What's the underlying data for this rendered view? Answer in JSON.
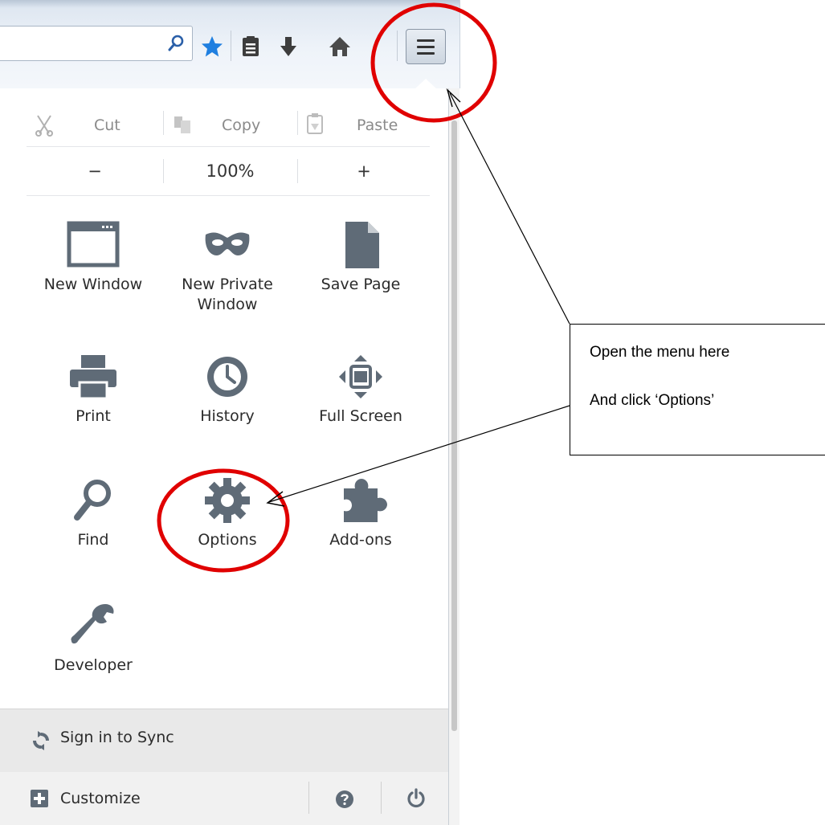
{
  "edit": {
    "cut": "Cut",
    "copy": "Copy",
    "paste": "Paste"
  },
  "zoom": {
    "minus": "−",
    "level": "100%",
    "plus": "+"
  },
  "grid": {
    "new_window": "New Window",
    "new_private_line1": "New Private",
    "new_private_line2": "Window",
    "save_page": "Save Page",
    "print": "Print",
    "history": "History",
    "full_screen": "Full Screen",
    "find": "Find",
    "options": "Options",
    "addons": "Add-ons",
    "developer": "Developer"
  },
  "footer": {
    "sync": "Sign in to Sync",
    "customize": "Customize"
  },
  "annotation": {
    "line1": "Open the menu here",
    "line2": "And click ‘Options’",
    "highlight_color": "#e00000"
  },
  "colors": {
    "star": "#1f7fe0",
    "icon_gray": "#5f6b77"
  },
  "icons": [
    "search-icon",
    "star-icon",
    "reading-list-icon",
    "download-icon",
    "home-icon",
    "hamburger-menu-icon",
    "cut-icon",
    "copy-icon",
    "paste-icon",
    "new-window-icon",
    "mask-icon",
    "page-icon",
    "printer-icon",
    "clock-icon",
    "fullscreen-icon",
    "magnifier-icon",
    "gear-icon",
    "puzzle-icon",
    "wrench-icon",
    "sync-icon",
    "plus-box-icon",
    "help-icon",
    "power-icon"
  ]
}
